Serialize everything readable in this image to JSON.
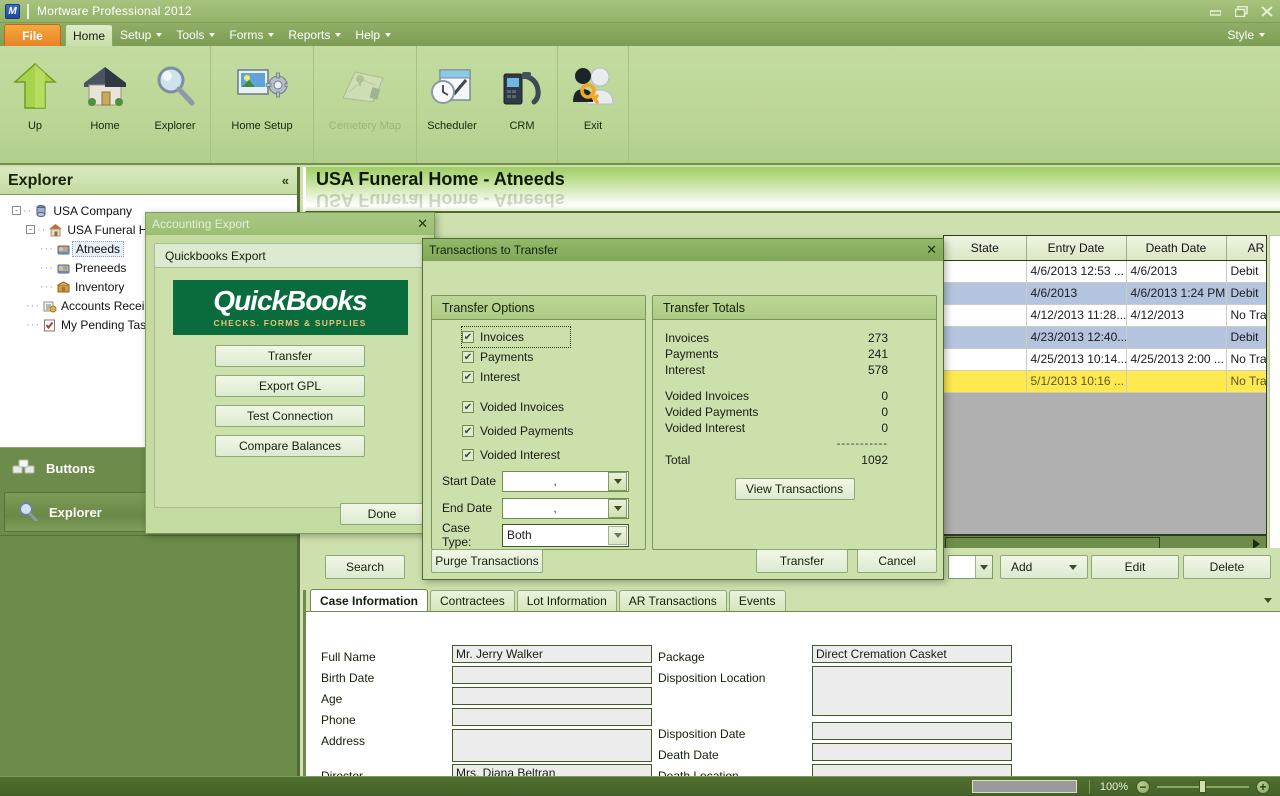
{
  "window": {
    "app_title": "Mortware Professional 2012",
    "logo_text": "M",
    "minimize": "minimize-icon",
    "restore": "restore-icon",
    "close": "close-icon"
  },
  "ribbon": {
    "file_tab": "File",
    "home_tab": "Home",
    "menus": [
      "Setup",
      "Tools",
      "Forms",
      "Reports",
      "Help"
    ],
    "style_label": "Style"
  },
  "toolbar": {
    "buttons": [
      {
        "label": "Up",
        "icon": "up-arrow-icon",
        "disabled": false
      },
      {
        "label": "Home",
        "icon": "house-icon",
        "disabled": false
      },
      {
        "label": "Explorer",
        "icon": "magnifier-icon",
        "disabled": false
      },
      {
        "label": "Home Setup",
        "icon": "settings-image-icon",
        "disabled": false
      },
      {
        "label": "Cemetery Map",
        "icon": "map-icon",
        "disabled": true
      },
      {
        "label": "Scheduler",
        "icon": "calendar-clock-icon",
        "disabled": false
      },
      {
        "label": "CRM",
        "icon": "telephone-icon",
        "disabled": false
      },
      {
        "label": "Exit",
        "icon": "user-key-icon",
        "disabled": false
      }
    ]
  },
  "sidebar": {
    "header": "Explorer",
    "collapse_glyph": "«",
    "tree": [
      {
        "label": "USA Company",
        "level": 0,
        "icon": "company-icon",
        "expander": "-",
        "selected": false
      },
      {
        "label": "USA Funeral H",
        "level": 1,
        "icon": "funeral-home-icon",
        "expander": "-",
        "selected": false
      },
      {
        "label": "Atneeds",
        "level": 2,
        "icon": "atneeds-icon",
        "expander": "",
        "selected": true
      },
      {
        "label": "Preneeds",
        "level": 2,
        "icon": "preneeds-icon",
        "expander": "",
        "selected": false
      },
      {
        "label": "Inventory",
        "level": 2,
        "icon": "inventory-icon",
        "expander": "",
        "selected": false
      },
      {
        "label": "Accounts Recei",
        "level": 1,
        "icon": "accounts-receivable-icon",
        "expander": "",
        "selected": false
      },
      {
        "label": "My Pending Tas",
        "level": 1,
        "icon": "pending-tasks-icon",
        "expander": "",
        "selected": false
      }
    ],
    "panels": [
      {
        "label": "Buttons",
        "icon": "buttons-icon",
        "active": false
      },
      {
        "label": "Explorer",
        "icon": "magnifier-icon",
        "active": true
      }
    ]
  },
  "page": {
    "title": "USA Funeral Home - Atneeds"
  },
  "grid": {
    "columns": [
      "State",
      "Entry Date",
      "Death Date",
      "AR"
    ],
    "rows": [
      {
        "state": "",
        "entry_date": "4/6/2013 12:53 ...",
        "death_date": "4/6/2013",
        "ar": "Debit",
        "style": "white"
      },
      {
        "state": "",
        "entry_date": "4/6/2013",
        "death_date": "4/6/2013 1:24 PM",
        "ar": "Debit",
        "style": "blue"
      },
      {
        "state": "",
        "entry_date": "4/12/2013 11:28...",
        "death_date": "4/12/2013",
        "ar": "No Tra",
        "style": "white"
      },
      {
        "state": "",
        "entry_date": "4/23/2013 12:40...",
        "death_date": "",
        "ar": "Debit",
        "style": "blue"
      },
      {
        "state": "",
        "entry_date": "4/25/2013 10:14...",
        "death_date": "4/25/2013 2:00 ...",
        "ar": "No Tra",
        "style": "white"
      },
      {
        "state": "",
        "entry_date": "5/1/2013 10:16 ...",
        "death_date": "",
        "ar": "No Tra",
        "style": "yellow"
      }
    ]
  },
  "searchbar": {
    "search_label": "Search",
    "add_label": "Add",
    "edit_label": "Edit",
    "delete_label": "Delete",
    "combo_value": ""
  },
  "form": {
    "tabs": [
      {
        "label": "Case Information",
        "active": true
      },
      {
        "label": "Contractees",
        "active": false
      },
      {
        "label": "Lot Information",
        "active": false
      },
      {
        "label": "AR Transactions",
        "active": false
      },
      {
        "label": "Events",
        "active": false
      }
    ],
    "left_fields": [
      {
        "label": "Full Name",
        "value": "Mr. Jerry Walker"
      },
      {
        "label": "Birth Date",
        "value": ""
      },
      {
        "label": "Age",
        "value": ""
      },
      {
        "label": "Phone",
        "value": ""
      },
      {
        "label": "Address",
        "value": ""
      },
      {
        "label": "Director",
        "value": "Mrs. Diana Beltran"
      }
    ],
    "right_fields": [
      {
        "label": "Package",
        "value": "Direct Cremation Casket"
      },
      {
        "label": "Disposition Location",
        "value": ""
      },
      {
        "label": "Disposition Date",
        "value": ""
      },
      {
        "label": "Death Date",
        "value": ""
      },
      {
        "label": "Death Location",
        "value": ""
      }
    ]
  },
  "accounting_export": {
    "title": "Accounting Export",
    "close_glyph": "✕",
    "group_title": "Quickbooks Export",
    "logo_main": "QuickBooks",
    "logo_sub": "CHECKS. FORMS & SUPPLIES",
    "buttons": [
      "Transfer",
      "Export GPL",
      "Test Connection",
      "Compare Balances"
    ],
    "done_label": "Done"
  },
  "transactions_dialog": {
    "title": "Transactions to Transfer",
    "close_glyph": "✕",
    "options_group": "Transfer Options",
    "checkboxes": [
      {
        "label": "Invoices",
        "checked": true,
        "focused": true
      },
      {
        "label": "Payments",
        "checked": true,
        "focused": false
      },
      {
        "label": "Interest",
        "checked": true,
        "focused": false
      },
      {
        "label": "Voided Invoices",
        "checked": true,
        "focused": false
      },
      {
        "label": "Voided Payments",
        "checked": true,
        "focused": false
      },
      {
        "label": "Voided Interest",
        "checked": true,
        "focused": false
      }
    ],
    "start_date": {
      "label": "Start Date",
      "value": ","
    },
    "end_date": {
      "label": "End Date",
      "value": ","
    },
    "case_type": {
      "label": "Case Type:",
      "value": "Both"
    },
    "totals_group": "Transfer Totals",
    "totals": [
      {
        "name": "Invoices",
        "value": "273"
      },
      {
        "name": "Payments",
        "value": "241"
      },
      {
        "name": "Interest",
        "value": "578"
      },
      {
        "name": "Voided Invoices",
        "value": "0"
      },
      {
        "name": "Voided Payments",
        "value": "0"
      },
      {
        "name": "Voided Interest",
        "value": "0"
      }
    ],
    "total_rule": "-----------",
    "total": {
      "name": "Total",
      "value": "1092"
    },
    "view_transactions_label": "View Transactions",
    "purge_label": "Purge Transactions",
    "transfer_label": "Transfer",
    "cancel_label": "Cancel"
  },
  "statusbar": {
    "zoom_percent": "100%",
    "zoom_out": "−",
    "zoom_in": "+"
  },
  "colors": {
    "accent_green": "#6d8b4a",
    "file_orange": "#e8832a",
    "row_highlight_yellow": "#ffe94f",
    "row_selected_blue": "#b4c4de",
    "quickbooks_green": "#0a6b3d"
  }
}
